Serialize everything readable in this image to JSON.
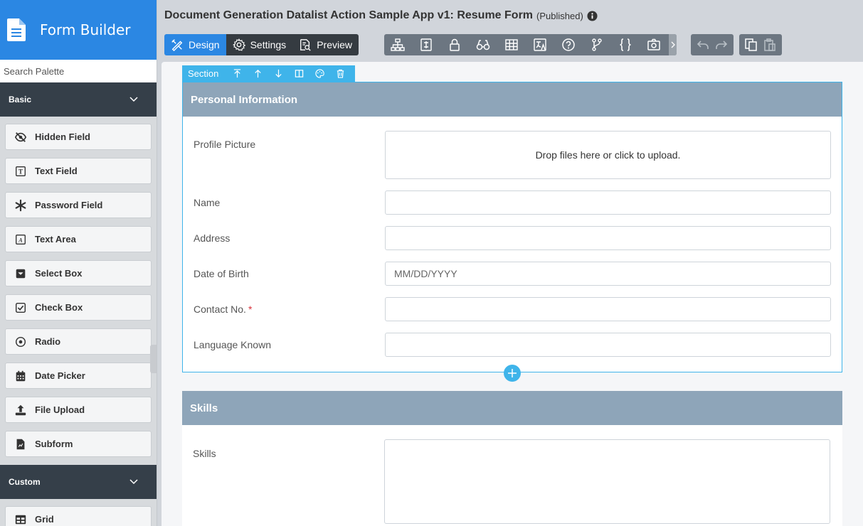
{
  "app": {
    "title": "Form Builder"
  },
  "search": {
    "placeholder": "Search Palette"
  },
  "palette": {
    "basic_label": "Basic",
    "custom_label": "Custom",
    "items": [
      {
        "label": "Hidden Field",
        "icon": "eye-slash-icon"
      },
      {
        "label": "Text Field",
        "icon": "text-field-icon"
      },
      {
        "label": "Password Field",
        "icon": "asterisk-icon"
      },
      {
        "label": "Text Area",
        "icon": "text-area-icon"
      },
      {
        "label": "Select Box",
        "icon": "select-box-icon"
      },
      {
        "label": "Check Box",
        "icon": "checkbox-icon"
      },
      {
        "label": "Radio",
        "icon": "radio-icon"
      },
      {
        "label": "Date Picker",
        "icon": "calendar-icon"
      },
      {
        "label": "File Upload",
        "icon": "upload-icon"
      },
      {
        "label": "Subform",
        "icon": "subform-icon"
      }
    ],
    "custom_items": [
      {
        "label": "Grid",
        "icon": "grid-icon"
      }
    ]
  },
  "header": {
    "form_title": "Document Generation Datalist Action Sample App v1: Resume Form",
    "status": "(Published)"
  },
  "modes": {
    "design": "Design",
    "settings": "Settings",
    "preview": "Preview"
  },
  "section_toolbar": {
    "label": "Section"
  },
  "form": {
    "section1": {
      "title": "Personal Information",
      "profile_picture_label": "Profile Picture",
      "dropzone_text": "Drop files here or click to upload.",
      "name_label": "Name",
      "address_label": "Address",
      "dob_label": "Date of Birth",
      "dob_placeholder": "MM/DD/YYYY",
      "contact_label": "Contact No.",
      "required_mark": "*",
      "language_label": "Language Known"
    },
    "section2": {
      "title": "Skills",
      "skills_label": "Skills"
    }
  },
  "colors": {
    "brand": "#2b87e3",
    "section_header": "#8ea5b9",
    "selection": "#3fb4ea",
    "category_bg": "#353f49",
    "required": "#d9303a"
  }
}
